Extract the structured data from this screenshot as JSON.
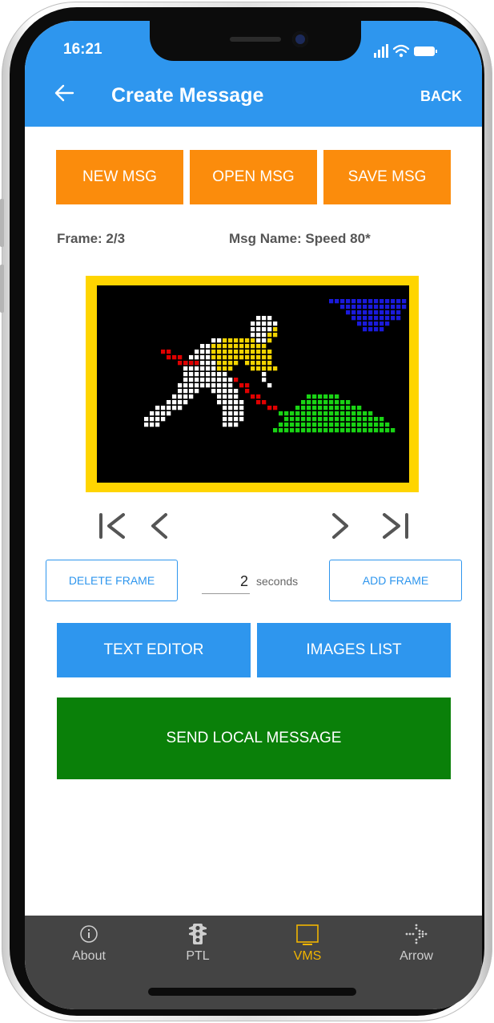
{
  "status_bar": {
    "time": "16:21"
  },
  "header": {
    "title": "Create Message",
    "back_label": "BACK",
    "back_icon": "arrow-left-icon"
  },
  "toolbar": {
    "new_msg": "NEW MSG",
    "open_msg": "OPEN MSG",
    "save_msg": "SAVE MSG"
  },
  "info": {
    "frame_label": "Frame:",
    "frame_value": "2/3",
    "msg_name_label": "Msg Name:",
    "msg_name_value": "Speed 80*"
  },
  "frame_nav": {
    "first": "first-frame-icon",
    "prev": "previous-frame-icon",
    "next": "next-frame-icon",
    "last": "last-frame-icon"
  },
  "frame_controls": {
    "delete": "DELETE FRAME",
    "add": "ADD FRAME",
    "duration_value": "2",
    "duration_unit": "seconds"
  },
  "editors": {
    "text_editor": "TEXT EDITOR",
    "images_list": "IMAGES LIST"
  },
  "send": {
    "label": "SEND LOCAL MESSAGE"
  },
  "bottom_nav": [
    {
      "label": "About",
      "icon": "info-icon",
      "active": false
    },
    {
      "label": "PTL",
      "icon": "traffic-light-icon",
      "active": false
    },
    {
      "label": "VMS",
      "icon": "monitor-icon",
      "active": true
    },
    {
      "label": "Arrow",
      "icon": "arrow-board-icon",
      "active": false
    }
  ],
  "colors": {
    "primary": "#2e96ee",
    "accent": "#fb8c0c",
    "send": "#0a8009",
    "nav_bg": "#444444",
    "nav_active": "#f0b400",
    "led_frame": "#ffd500",
    "led_white": "#ffffff",
    "led_yellow": "#f3d400",
    "led_red": "#e00000",
    "led_green": "#19d414",
    "led_blue": "#1a1adc"
  },
  "led_image": {
    "description_icon": "road-works-man-digging-icon"
  }
}
